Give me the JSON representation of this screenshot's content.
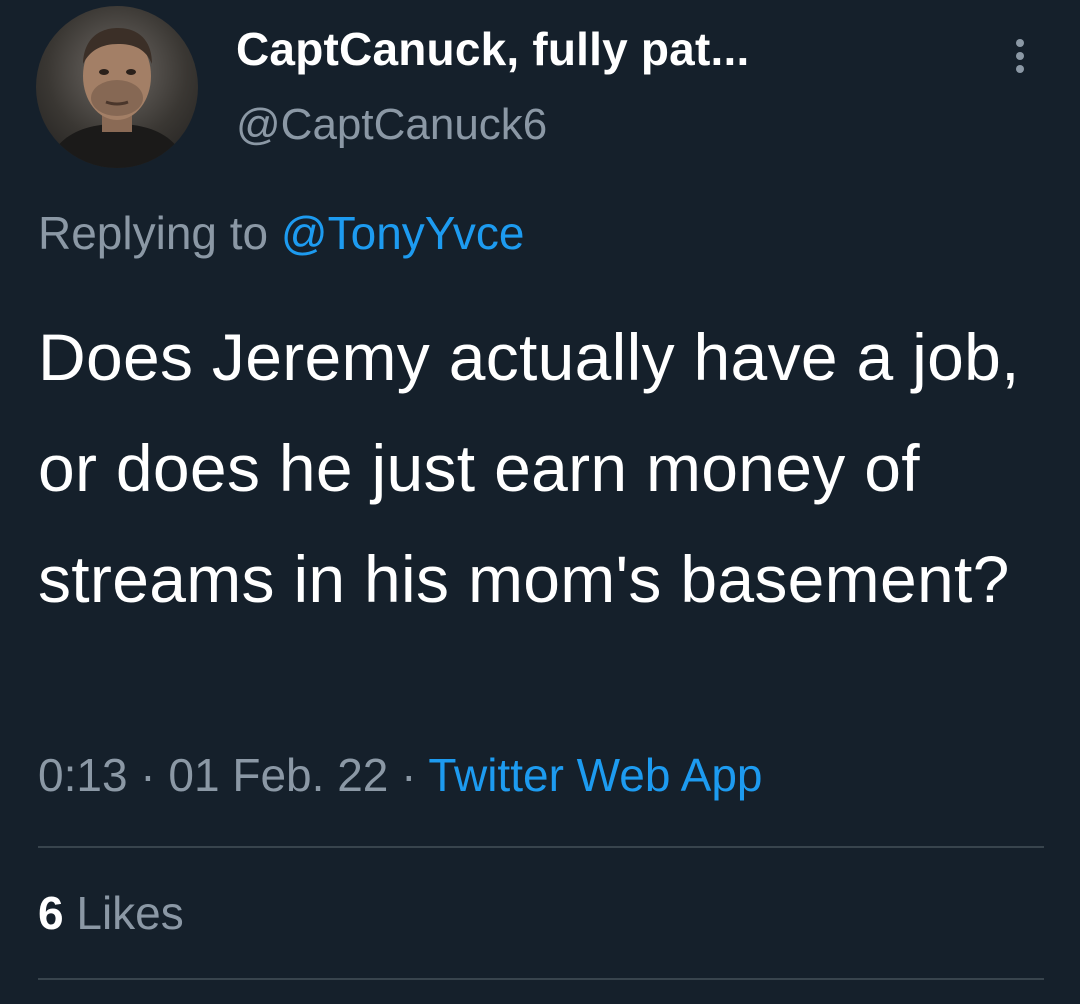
{
  "author": {
    "display_name": "CaptCanuck, fully pat...",
    "handle": "@CaptCanuck6"
  },
  "reply": {
    "prefix": "Replying to ",
    "to_handle": "@TonyYvce"
  },
  "tweet": {
    "text": "Does Jeremy actually have a job, or does he just earn money of streams in his mom's basement?"
  },
  "meta": {
    "time": "0:13",
    "separator_1": " · ",
    "date": "01 Feb. 22",
    "separator_2": " · ",
    "source": "Twitter Web App"
  },
  "stats": {
    "likes_count": "6",
    "likes_label": " Likes"
  },
  "icons": {
    "more": "more-vertical-icon"
  },
  "colors": {
    "background": "#15202b",
    "primary_text": "#ffffff",
    "secondary_text": "#8b98a5",
    "accent": "#1d9bf0",
    "divider": "#38444d"
  }
}
